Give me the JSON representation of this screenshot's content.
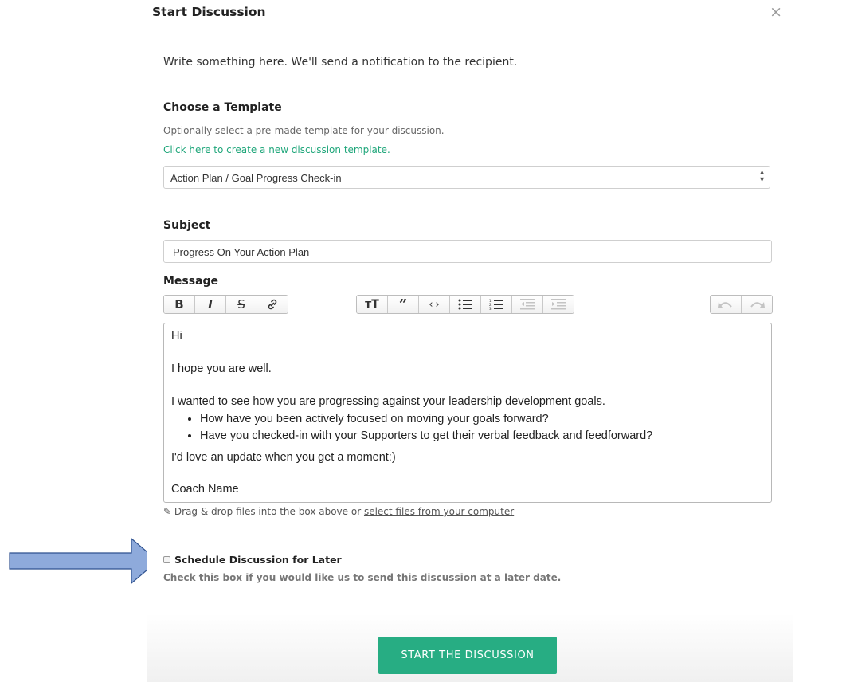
{
  "modal": {
    "title": "Start Discussion",
    "close_glyph": "×",
    "intro": "Write something here. We'll send a notification to the recipient."
  },
  "template": {
    "heading": "Choose a Template",
    "help": "Optionally select a pre-made template for your discussion.",
    "create_link": "Click here to create a new discussion template.",
    "selected": "Action Plan / Goal Progress Check-in"
  },
  "subject": {
    "heading": "Subject",
    "value": "Progress On Your Action Plan"
  },
  "message": {
    "heading": "Message",
    "toolbar_icons": [
      "bold-icon",
      "italic-icon",
      "strikethrough-icon",
      "link-icon",
      "heading-icon",
      "quote-icon",
      "code-icon",
      "bullet-list-icon",
      "numbered-list-icon",
      "outdent-icon",
      "indent-icon",
      "undo-icon",
      "redo-icon"
    ],
    "body": {
      "greeting": "Hi",
      "line1": "I hope you are well.",
      "line2": "I wanted to see how you are progressing against your leadership development goals.",
      "bullets": [
        "How have you been actively focused on moving your goals forward?",
        "Have you checked-in with your Supporters to get their verbal feedback and feedforward?"
      ],
      "line3": "I'd love an update when you get a moment:)",
      "signature": "Coach Name"
    },
    "dnd_text": "Drag & drop files into the box above or ",
    "dnd_link": "select files from your computer"
  },
  "schedule": {
    "label": "Schedule Discussion for Later",
    "help": "Check this box if you would like us to send this discussion at a later date.",
    "checked": false
  },
  "footer": {
    "start_button": "START THE DISCUSSION"
  },
  "colors": {
    "accent": "#27ad83",
    "link": "#1fa67a",
    "arrow": "#8eaadb"
  }
}
